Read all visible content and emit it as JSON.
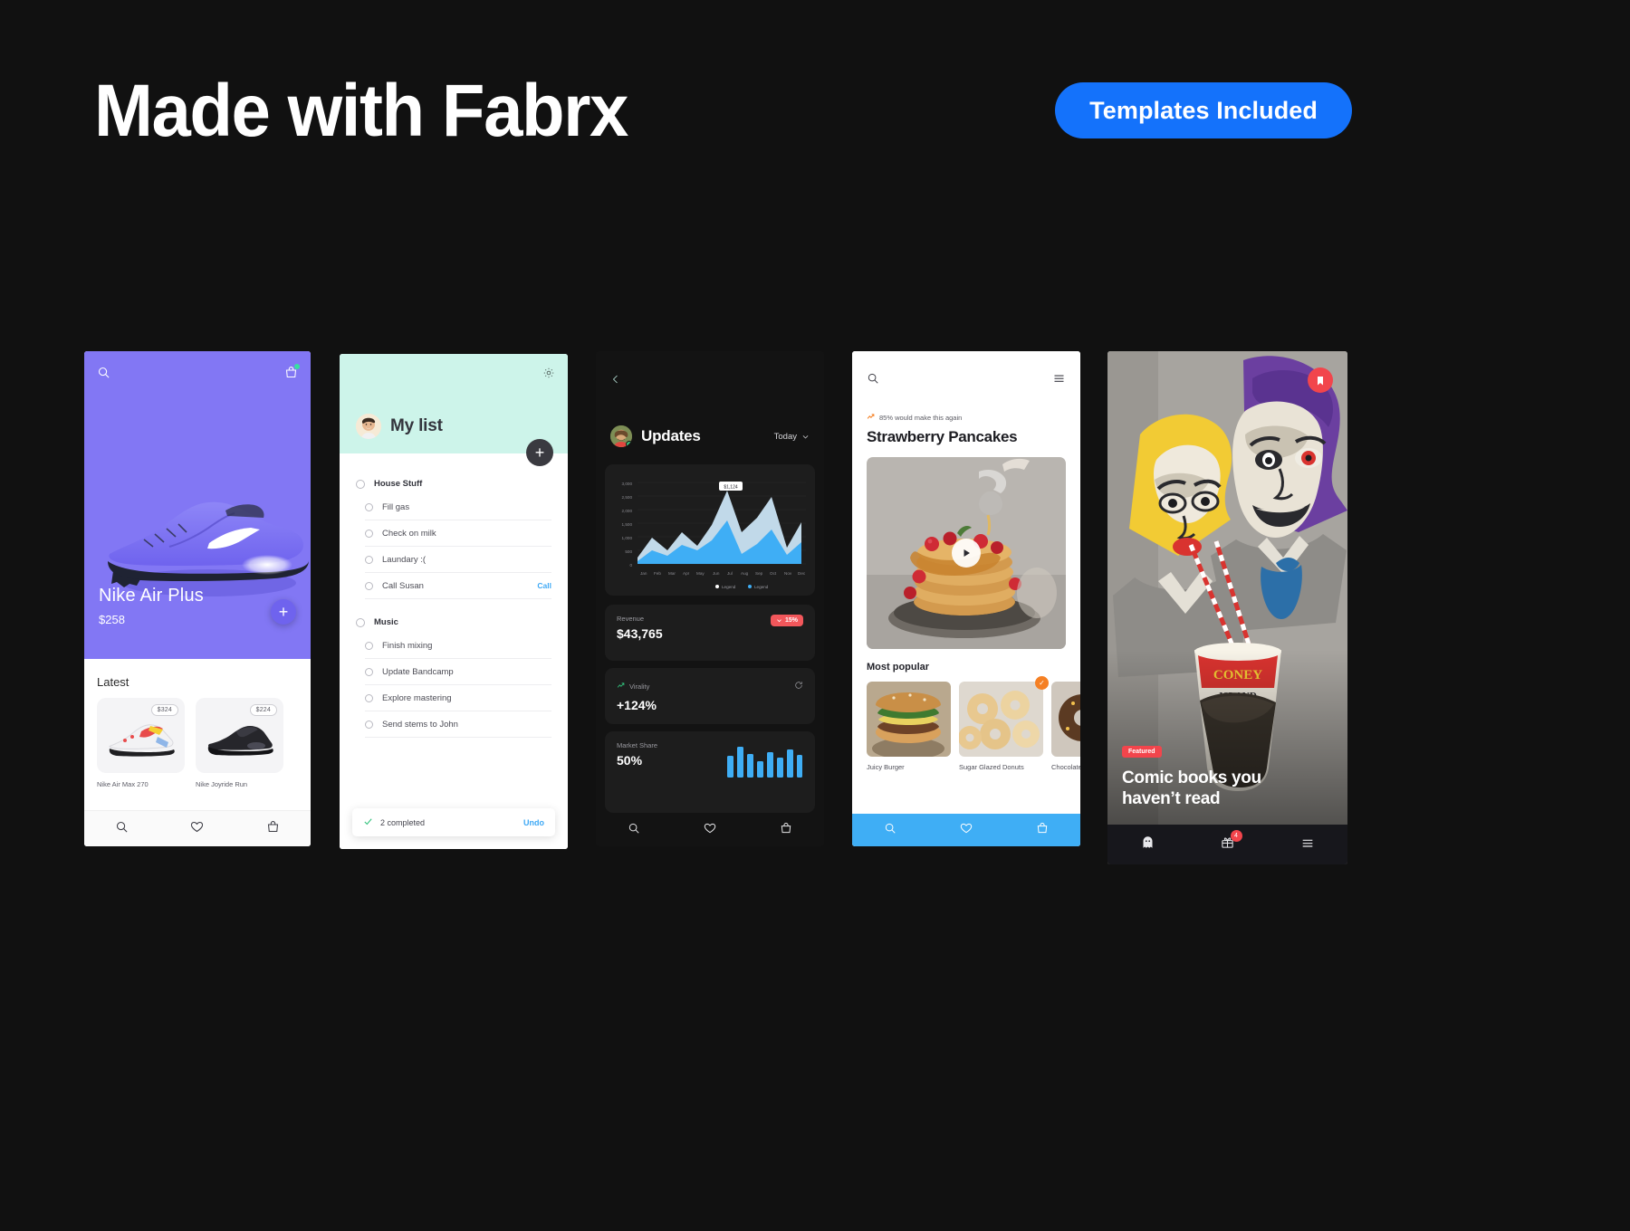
{
  "header": {
    "title": "Made with Fabrx",
    "pill_label": "Templates Included",
    "accent_blue": "#1472FB",
    "background": "#111111"
  },
  "phone_nike": {
    "hero_bg": "#8277F4",
    "search_icon": "search-icon",
    "bag_icon": "shopping-bag-icon",
    "product_title": "Nike Air Plus",
    "product_price": "$258",
    "add_label": "+",
    "section_title": "Latest",
    "products": [
      {
        "name": "Nike Air Max 270",
        "price": "$324"
      },
      {
        "name": "Nike Joyride Run",
        "price": "$224"
      }
    ],
    "tabs": [
      "search-icon",
      "heart-icon",
      "bag-icon"
    ]
  },
  "phone_list": {
    "header_bg": "#CDF4EA",
    "title": "My list",
    "gear_icon": "gear-icon",
    "add_label": "+",
    "groups": [
      {
        "label": "House Stuff",
        "tasks": [
          {
            "label": "Fill gas",
            "action": ""
          },
          {
            "label": "Check on milk",
            "action": ""
          },
          {
            "label": "Laundary :(",
            "action": ""
          },
          {
            "label": "Call Susan",
            "action": "Call"
          }
        ]
      },
      {
        "label": "Music",
        "tasks": [
          {
            "label": "Finish mixing",
            "action": ""
          },
          {
            "label": "Update Bandcamp",
            "action": ""
          },
          {
            "label": "Explore mastering",
            "action": ""
          },
          {
            "label": "Send stems to John",
            "action": ""
          }
        ]
      }
    ],
    "footer": {
      "completed": "2 completed",
      "undo": "Undo"
    }
  },
  "phone_dashboard": {
    "bg": "#131313",
    "back_icon": "chevron-left-icon",
    "title": "Updates",
    "range_label": "Today",
    "chart_tooltip": "$1,124",
    "legend": [
      "Legend",
      "Legend"
    ],
    "stats": [
      {
        "label": "Revenue",
        "value": "$43,765",
        "delta": "15%",
        "delta_dir": "down",
        "icon": ""
      },
      {
        "label": "Virality",
        "value": "+124%",
        "delta": "",
        "delta_dir": "up",
        "icon": "trend-up-icon"
      },
      {
        "label": "Market Share",
        "value": "50%",
        "delta": "",
        "delta_dir": "",
        "icon": ""
      }
    ],
    "tabs": [
      "search-icon",
      "heart-icon",
      "bag-icon"
    ]
  },
  "phone_recipe": {
    "search_icon": "search-icon",
    "menu_icon": "hamburger-menu-icon",
    "kicker": "85% would make this again",
    "title": "Strawberry Pancakes",
    "play_icon": "play-icon",
    "section_title": "Most popular",
    "thumbs": [
      {
        "name": "Juicy Burger",
        "badge": ""
      },
      {
        "name": "Sugar Glazed Donuts",
        "badge": "✓"
      },
      {
        "name": "Chocolate Sprinkles",
        "badge": ""
      }
    ],
    "tabbar_color": "#3FAEF5",
    "tabs": [
      "search-icon",
      "heart-icon",
      "bag-icon"
    ]
  },
  "phone_comic": {
    "bookmark_icon": "bookmark-icon",
    "badge_label": "Featured",
    "headline": "Comic books you haven’t read",
    "gift_count": "4",
    "tabs": [
      "ghost-icon",
      "gift-icon",
      "hamburger-menu-icon"
    ]
  },
  "chart_data": {
    "type": "area",
    "title": "Updates",
    "categories": [
      "Jan",
      "Feb",
      "Mar",
      "Apr",
      "May",
      "Jun",
      "Jul",
      "Aug",
      "Sep",
      "Oct",
      "Nov",
      "Dec"
    ],
    "series": [
      {
        "name": "Legend",
        "values": [
          420,
          980,
          640,
          1180,
          760,
          1320,
          2100,
          1180,
          1560,
          2480,
          900,
          1480
        ]
      },
      {
        "name": "Legend",
        "values": [
          260,
          520,
          380,
          700,
          520,
          880,
          1480,
          760,
          1040,
          1760,
          600,
          980
        ]
      }
    ],
    "yticks": [
      "3,000",
      "2,500",
      "2,000",
      "1,500",
      "1,000",
      "500",
      "0"
    ],
    "ylim": [
      0,
      3000
    ],
    "grid": true,
    "legend_position": "bottom-right",
    "annotation": "$1,124",
    "colors": [
      "#CFE9FB",
      "#3FAEF5"
    ]
  },
  "bar_chart_data": {
    "type": "bar",
    "title": "Market Share",
    "value_label": "50%",
    "values": [
      46,
      74,
      52,
      38,
      60,
      44,
      68,
      50
    ],
    "color": "#3FAEF5"
  }
}
